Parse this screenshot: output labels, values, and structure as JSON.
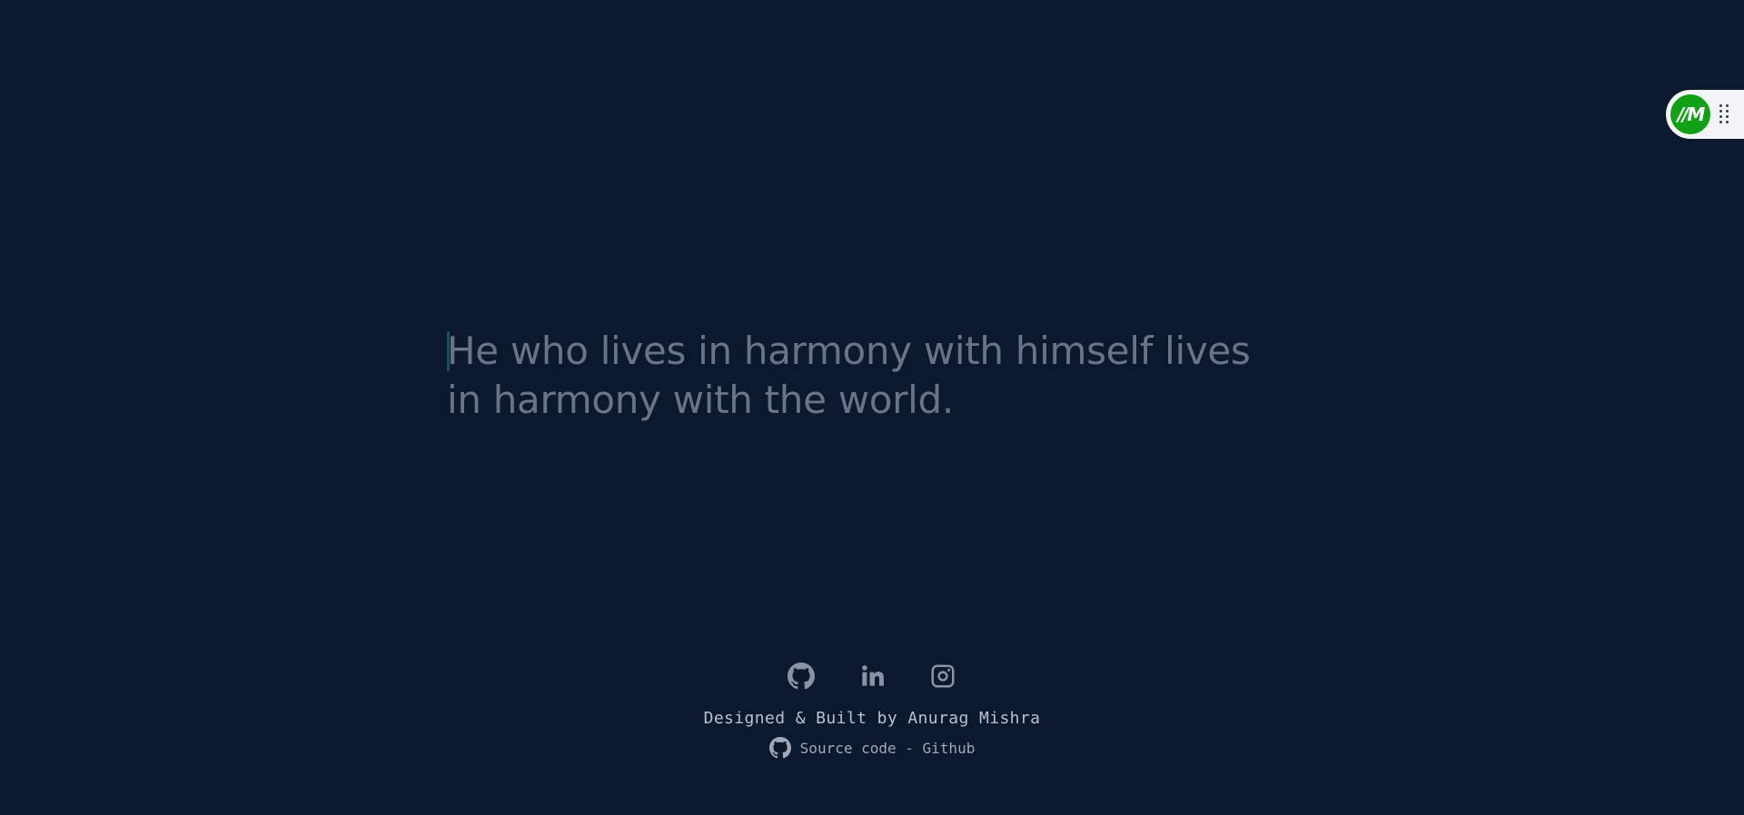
{
  "quote": {
    "text": "He who lives in harmony with himself lives in harmony with the world."
  },
  "footer": {
    "social_icons": [
      "github-icon",
      "linkedin-icon",
      "instagram-icon"
    ],
    "credit": "Designed & Built by Anurag Mishra",
    "source_label": "Source code - Github"
  },
  "extension_widget": {
    "logo_text": "//M"
  },
  "colors": {
    "background": "#0b192f",
    "quote_text": "#6b7386",
    "caret": "#1d4b59",
    "widget_logo": "#12a116"
  }
}
